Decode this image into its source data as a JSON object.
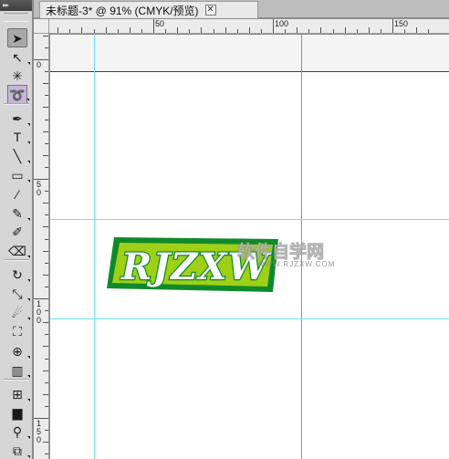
{
  "document": {
    "tab_title": "未标题-3* @ 91% (CMYK/预览)",
    "close_glyph": "✕"
  },
  "tools_panel": {
    "header_glyph": "▸▸",
    "tools": [
      {
        "id": "selection",
        "icon": "selection-arrow-icon",
        "glyph": "➤",
        "state": "active"
      },
      {
        "id": "direct-selection",
        "icon": "direct-selection-icon",
        "glyph": "↖"
      },
      {
        "id": "magic-wand",
        "icon": "magic-wand-icon",
        "glyph": "✳"
      },
      {
        "id": "lasso",
        "icon": "lasso-icon",
        "glyph": "➰",
        "state": "selected"
      },
      {
        "id": "pen",
        "icon": "pen-icon",
        "glyph": "✒"
      },
      {
        "id": "type",
        "icon": "type-icon",
        "glyph": "T"
      },
      {
        "id": "line",
        "icon": "line-segment-icon",
        "glyph": "╲"
      },
      {
        "id": "rectangle",
        "icon": "rectangle-icon",
        "glyph": "▭"
      },
      {
        "id": "paintbrush",
        "icon": "paintbrush-icon",
        "glyph": "⁄"
      },
      {
        "id": "pencil",
        "icon": "pencil-icon",
        "glyph": "✎"
      },
      {
        "id": "blob-brush",
        "icon": "blob-brush-icon",
        "glyph": "✐"
      },
      {
        "id": "eraser",
        "icon": "eraser-icon",
        "glyph": "⌫"
      },
      {
        "id": "rotate",
        "icon": "rotate-icon",
        "glyph": "↻"
      },
      {
        "id": "scale",
        "icon": "scale-icon",
        "glyph": "⤡"
      },
      {
        "id": "warp",
        "icon": "warp-icon",
        "glyph": "☄"
      },
      {
        "id": "free-transform",
        "icon": "free-transform-icon",
        "glyph": "⛶"
      },
      {
        "id": "shape-builder",
        "icon": "shape-builder-icon",
        "glyph": "⊕"
      },
      {
        "id": "graph",
        "icon": "column-graph-icon",
        "glyph": "▥"
      },
      {
        "id": "mesh",
        "icon": "mesh-icon",
        "glyph": "⊞"
      },
      {
        "id": "gradient",
        "icon": "gradient-icon",
        "glyph": "▆"
      },
      {
        "id": "eyedropper",
        "icon": "eyedropper-icon",
        "glyph": "⚲"
      },
      {
        "id": "blend",
        "icon": "blend-icon",
        "glyph": "⧉"
      }
    ]
  },
  "rulers": {
    "horizontal_labels": [
      "50",
      "100",
      "150"
    ],
    "vertical_labels": [
      [
        "0"
      ],
      [
        "5",
        "0"
      ],
      [
        "1",
        "0",
        "0"
      ],
      [
        "1",
        "5",
        "0"
      ]
    ]
  },
  "artwork": {
    "logo_text": "RJZXW",
    "colors": {
      "outer": "#0f8a2a",
      "inner": "#9fd017",
      "letters": "#ffffff",
      "letter_stroke": "#0f8a2a"
    },
    "watermark_main": "软件自学网",
    "watermark_url": "WWW.RJZXW.COM"
  },
  "colors": {
    "guide": "#6fe2ef",
    "guide_selected": "#6f8fe8",
    "pasteboard": "#f4f4f4"
  }
}
